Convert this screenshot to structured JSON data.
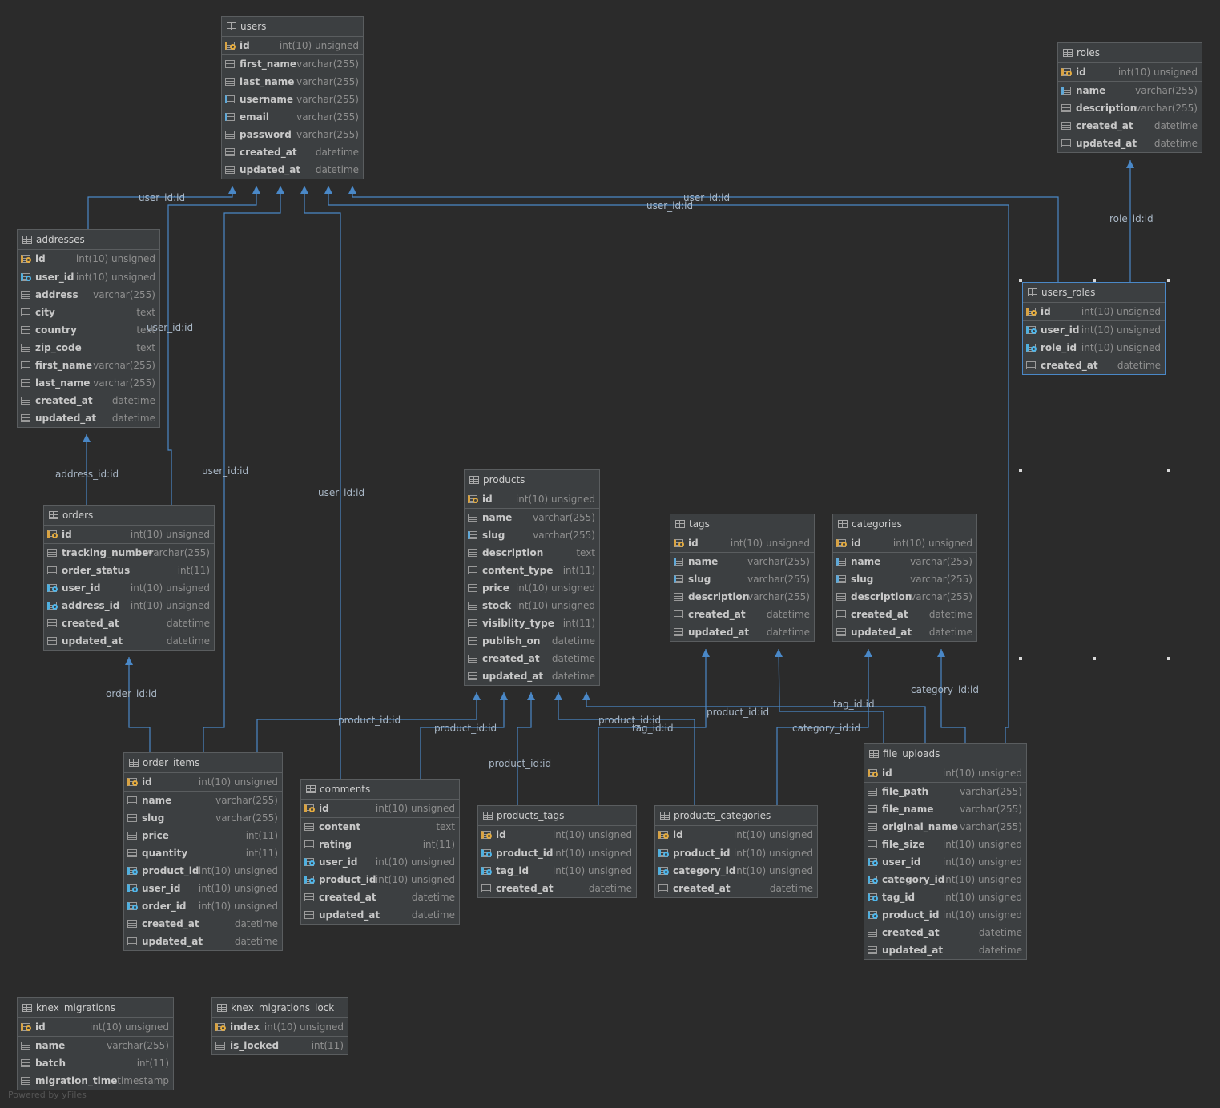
{
  "tables": [
    {
      "key": "users",
      "name": "users",
      "columns": [
        {
          "name": "id",
          "type": "int(10) unsigned",
          "kind": "pk"
        },
        {
          "name": "first_name",
          "type": "varchar(255)",
          "kind": "col"
        },
        {
          "name": "last_name",
          "type": "varchar(255)",
          "kind": "col"
        },
        {
          "name": "username",
          "type": "varchar(255)",
          "kind": "idx"
        },
        {
          "name": "email",
          "type": "varchar(255)",
          "kind": "idx"
        },
        {
          "name": "password",
          "type": "varchar(255)",
          "kind": "col"
        },
        {
          "name": "created_at",
          "type": "datetime",
          "kind": "col"
        },
        {
          "name": "updated_at",
          "type": "datetime",
          "kind": "col"
        }
      ]
    },
    {
      "key": "roles",
      "name": "roles",
      "columns": [
        {
          "name": "id",
          "type": "int(10) unsigned",
          "kind": "pk"
        },
        {
          "name": "name",
          "type": "varchar(255)",
          "kind": "idx"
        },
        {
          "name": "description",
          "type": "varchar(255)",
          "kind": "col"
        },
        {
          "name": "created_at",
          "type": "datetime",
          "kind": "col"
        },
        {
          "name": "updated_at",
          "type": "datetime",
          "kind": "col"
        }
      ]
    },
    {
      "key": "addresses",
      "name": "addresses",
      "columns": [
        {
          "name": "id",
          "type": "int(10) unsigned",
          "kind": "pk"
        },
        {
          "name": "user_id",
          "type": "int(10) unsigned",
          "kind": "fk"
        },
        {
          "name": "address",
          "type": "varchar(255)",
          "kind": "col"
        },
        {
          "name": "city",
          "type": "text",
          "kind": "col"
        },
        {
          "name": "country",
          "type": "text",
          "kind": "col"
        },
        {
          "name": "zip_code",
          "type": "text",
          "kind": "col"
        },
        {
          "name": "first_name",
          "type": "varchar(255)",
          "kind": "col"
        },
        {
          "name": "last_name",
          "type": "varchar(255)",
          "kind": "col"
        },
        {
          "name": "created_at",
          "type": "datetime",
          "kind": "col"
        },
        {
          "name": "updated_at",
          "type": "datetime",
          "kind": "col"
        }
      ]
    },
    {
      "key": "users_roles",
      "name": "users_roles",
      "selected": true,
      "columns": [
        {
          "name": "id",
          "type": "int(10) unsigned",
          "kind": "pk"
        },
        {
          "name": "user_id",
          "type": "int(10) unsigned",
          "kind": "fk"
        },
        {
          "name": "role_id",
          "type": "int(10) unsigned",
          "kind": "fk"
        },
        {
          "name": "created_at",
          "type": "datetime",
          "kind": "col"
        }
      ]
    },
    {
      "key": "orders",
      "name": "orders",
      "columns": [
        {
          "name": "id",
          "type": "int(10) unsigned",
          "kind": "pk"
        },
        {
          "name": "tracking_number",
          "type": "varchar(255)",
          "kind": "col"
        },
        {
          "name": "order_status",
          "type": "int(11)",
          "kind": "col"
        },
        {
          "name": "user_id",
          "type": "int(10) unsigned",
          "kind": "fk"
        },
        {
          "name": "address_id",
          "type": "int(10) unsigned",
          "kind": "fk"
        },
        {
          "name": "created_at",
          "type": "datetime",
          "kind": "col"
        },
        {
          "name": "updated_at",
          "type": "datetime",
          "kind": "col"
        }
      ]
    },
    {
      "key": "products",
      "name": "products",
      "columns": [
        {
          "name": "id",
          "type": "int(10) unsigned",
          "kind": "pk"
        },
        {
          "name": "name",
          "type": "varchar(255)",
          "kind": "col"
        },
        {
          "name": "slug",
          "type": "varchar(255)",
          "kind": "idx"
        },
        {
          "name": "description",
          "type": "text",
          "kind": "col"
        },
        {
          "name": "content_type",
          "type": "int(11)",
          "kind": "col"
        },
        {
          "name": "price",
          "type": "int(10) unsigned",
          "kind": "col"
        },
        {
          "name": "stock",
          "type": "int(10) unsigned",
          "kind": "col"
        },
        {
          "name": "visiblity_type",
          "type": "int(11)",
          "kind": "col"
        },
        {
          "name": "publish_on",
          "type": "datetime",
          "kind": "col"
        },
        {
          "name": "created_at",
          "type": "datetime",
          "kind": "col"
        },
        {
          "name": "updated_at",
          "type": "datetime",
          "kind": "col"
        }
      ]
    },
    {
      "key": "tags",
      "name": "tags",
      "columns": [
        {
          "name": "id",
          "type": "int(10) unsigned",
          "kind": "pk"
        },
        {
          "name": "name",
          "type": "varchar(255)",
          "kind": "idx"
        },
        {
          "name": "slug",
          "type": "varchar(255)",
          "kind": "idx"
        },
        {
          "name": "description",
          "type": "varchar(255)",
          "kind": "col"
        },
        {
          "name": "created_at",
          "type": "datetime",
          "kind": "col"
        },
        {
          "name": "updated_at",
          "type": "datetime",
          "kind": "col"
        }
      ]
    },
    {
      "key": "categories",
      "name": "categories",
      "columns": [
        {
          "name": "id",
          "type": "int(10) unsigned",
          "kind": "pk"
        },
        {
          "name": "name",
          "type": "varchar(255)",
          "kind": "idx"
        },
        {
          "name": "slug",
          "type": "varchar(255)",
          "kind": "idx"
        },
        {
          "name": "description",
          "type": "varchar(255)",
          "kind": "col"
        },
        {
          "name": "created_at",
          "type": "datetime",
          "kind": "col"
        },
        {
          "name": "updated_at",
          "type": "datetime",
          "kind": "col"
        }
      ]
    },
    {
      "key": "order_items",
      "name": "order_items",
      "columns": [
        {
          "name": "id",
          "type": "int(10) unsigned",
          "kind": "pk"
        },
        {
          "name": "name",
          "type": "varchar(255)",
          "kind": "col"
        },
        {
          "name": "slug",
          "type": "varchar(255)",
          "kind": "col"
        },
        {
          "name": "price",
          "type": "int(11)",
          "kind": "col"
        },
        {
          "name": "quantity",
          "type": "int(11)",
          "kind": "col"
        },
        {
          "name": "product_id",
          "type": "int(10) unsigned",
          "kind": "fk"
        },
        {
          "name": "user_id",
          "type": "int(10) unsigned",
          "kind": "fk"
        },
        {
          "name": "order_id",
          "type": "int(10) unsigned",
          "kind": "fk"
        },
        {
          "name": "created_at",
          "type": "datetime",
          "kind": "col"
        },
        {
          "name": "updated_at",
          "type": "datetime",
          "kind": "col"
        }
      ]
    },
    {
      "key": "comments",
      "name": "comments",
      "columns": [
        {
          "name": "id",
          "type": "int(10) unsigned",
          "kind": "pk"
        },
        {
          "name": "content",
          "type": "text",
          "kind": "col"
        },
        {
          "name": "rating",
          "type": "int(11)",
          "kind": "col"
        },
        {
          "name": "user_id",
          "type": "int(10) unsigned",
          "kind": "fk"
        },
        {
          "name": "product_id",
          "type": "int(10) unsigned",
          "kind": "fk"
        },
        {
          "name": "created_at",
          "type": "datetime",
          "kind": "col"
        },
        {
          "name": "updated_at",
          "type": "datetime",
          "kind": "col"
        }
      ]
    },
    {
      "key": "products_tags",
      "name": "products_tags",
      "columns": [
        {
          "name": "id",
          "type": "int(10) unsigned",
          "kind": "pk"
        },
        {
          "name": "product_id",
          "type": "int(10) unsigned",
          "kind": "fk"
        },
        {
          "name": "tag_id",
          "type": "int(10) unsigned",
          "kind": "fk"
        },
        {
          "name": "created_at",
          "type": "datetime",
          "kind": "col"
        }
      ]
    },
    {
      "key": "products_categories",
      "name": "products_categories",
      "columns": [
        {
          "name": "id",
          "type": "int(10) unsigned",
          "kind": "pk"
        },
        {
          "name": "product_id",
          "type": "int(10) unsigned",
          "kind": "fk"
        },
        {
          "name": "category_id",
          "type": "int(10) unsigned",
          "kind": "fk"
        },
        {
          "name": "created_at",
          "type": "datetime",
          "kind": "col"
        }
      ]
    },
    {
      "key": "file_uploads",
      "name": "file_uploads",
      "columns": [
        {
          "name": "id",
          "type": "int(10) unsigned",
          "kind": "pk"
        },
        {
          "name": "file_path",
          "type": "varchar(255)",
          "kind": "col"
        },
        {
          "name": "file_name",
          "type": "varchar(255)",
          "kind": "col"
        },
        {
          "name": "original_name",
          "type": "varchar(255)",
          "kind": "col"
        },
        {
          "name": "file_size",
          "type": "int(10) unsigned",
          "kind": "col"
        },
        {
          "name": "user_id",
          "type": "int(10) unsigned",
          "kind": "fk"
        },
        {
          "name": "category_id",
          "type": "int(10) unsigned",
          "kind": "fk"
        },
        {
          "name": "tag_id",
          "type": "int(10) unsigned",
          "kind": "fk"
        },
        {
          "name": "product_id",
          "type": "int(10) unsigned",
          "kind": "fk"
        },
        {
          "name": "created_at",
          "type": "datetime",
          "kind": "col"
        },
        {
          "name": "updated_at",
          "type": "datetime",
          "kind": "col"
        }
      ]
    },
    {
      "key": "knex_migrations",
      "name": "knex_migrations",
      "columns": [
        {
          "name": "id",
          "type": "int(10) unsigned",
          "kind": "pk"
        },
        {
          "name": "name",
          "type": "varchar(255)",
          "kind": "col"
        },
        {
          "name": "batch",
          "type": "int(11)",
          "kind": "col"
        },
        {
          "name": "migration_time",
          "type": "timestamp",
          "kind": "col"
        }
      ]
    },
    {
      "key": "knex_migrations_lock",
      "name": "knex_migrations_lock",
      "columns": [
        {
          "name": "index",
          "type": "int(10) unsigned",
          "kind": "pk"
        },
        {
          "name": "is_locked",
          "type": "int(11)",
          "kind": "col"
        }
      ]
    }
  ],
  "relation_labels": {
    "users_addresses": "user_id:id",
    "users_orders": "user_id:id",
    "users_order_items": "user_id:id",
    "users_comments": "user_id:id",
    "users_file_uploads": "user_id:id",
    "users_users_roles": "user_id:id",
    "roles_users_roles": "role_id:id",
    "addresses_orders": "address_id:id",
    "orders_order_items": "order_id:id",
    "products_order_items": "product_id:id",
    "products_comments": "product_id:id",
    "products_products_tags": "product_id:id",
    "products_products_categories": "product_id:id",
    "products_file_uploads": "product_id:id",
    "tags_products_tags": "tag_id:id",
    "tags_file_uploads": "tag_id:id",
    "categories_products_categories": "category_id:id",
    "categories_file_uploads": "category_id:id"
  },
  "watermark": "Powered by yFiles",
  "colors": {
    "background": "#2b2b2b",
    "edge": "#4a88c7",
    "table_bg": "#3c3f41",
    "pk_key": "#e5ac3f",
    "fk_key": "#4fb6ea"
  }
}
